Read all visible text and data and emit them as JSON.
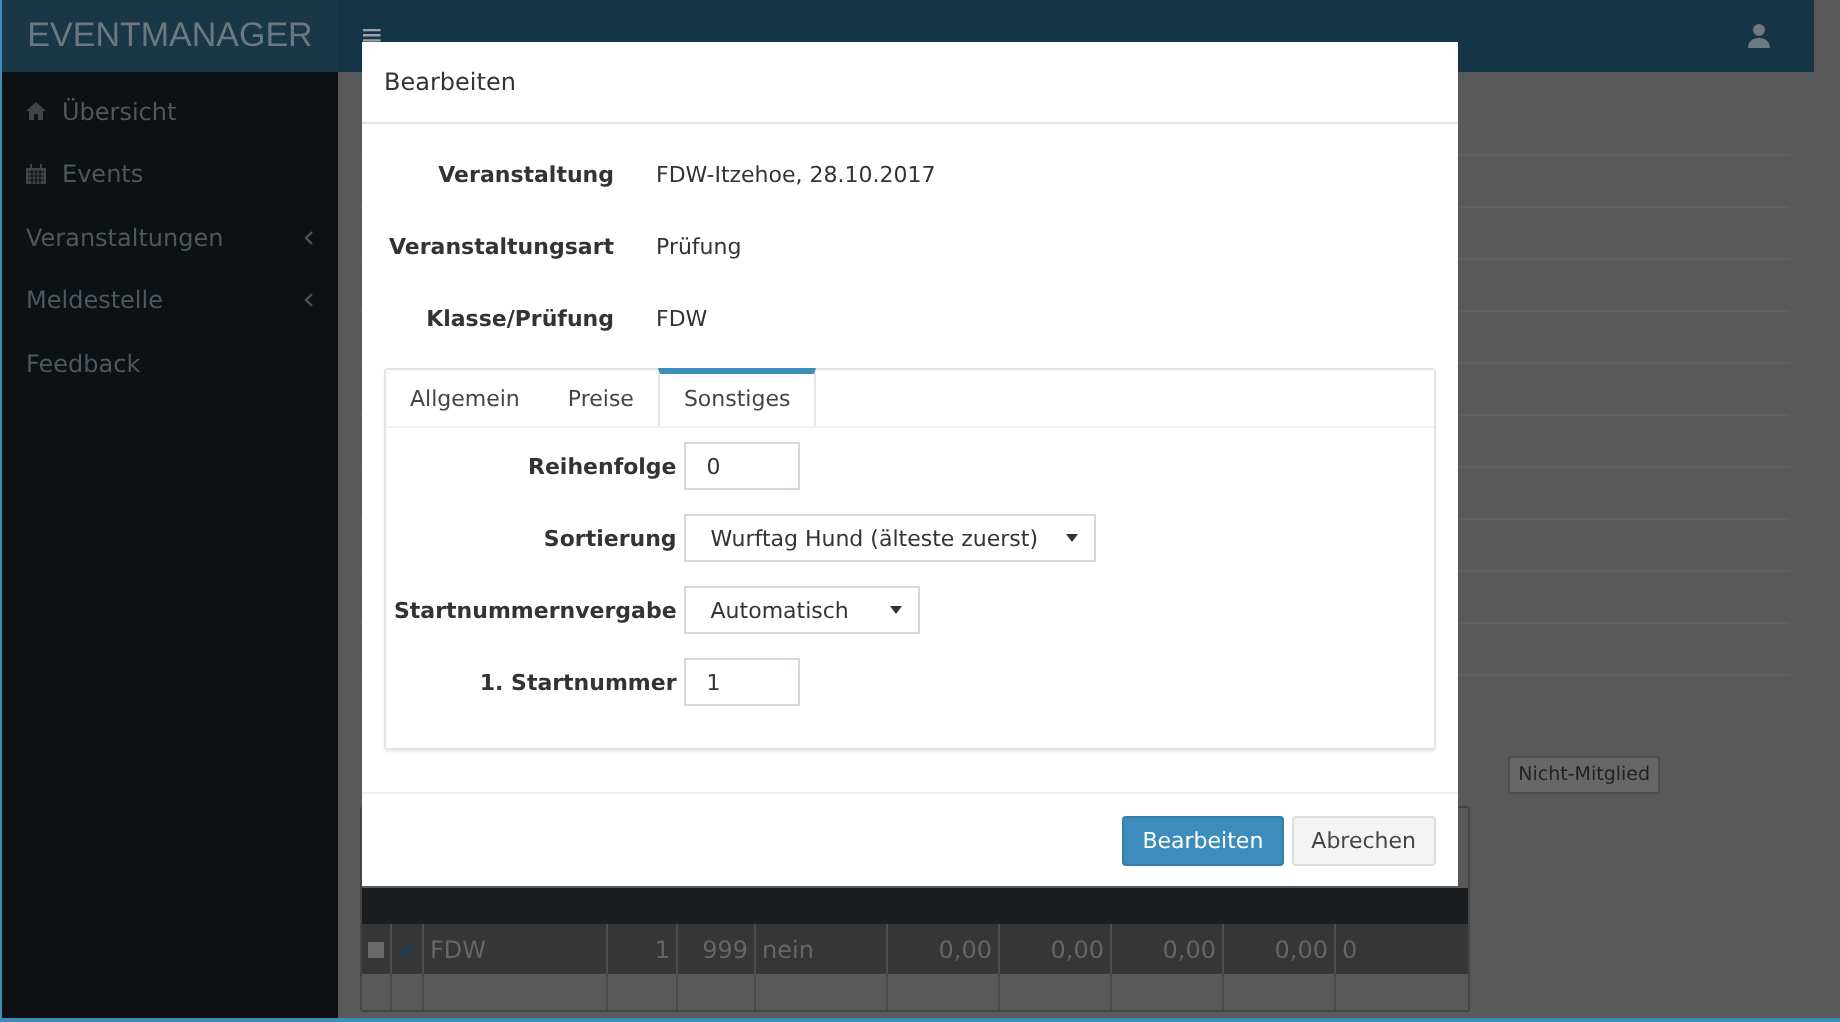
{
  "header": {
    "logo": "EVENTMANAGER",
    "menu_icon": "≡"
  },
  "sidebar": {
    "items": [
      {
        "label": "Übersicht",
        "kind": "home",
        "expandable": false
      },
      {
        "label": "Events",
        "kind": "calendar",
        "expandable": false
      },
      {
        "label": "Veranstaltungen",
        "kind": "none",
        "expandable": true
      },
      {
        "label": "Meldestelle",
        "kind": "none",
        "expandable": true
      },
      {
        "label": "Feedback",
        "kind": "none",
        "expandable": false
      }
    ]
  },
  "background": {
    "member_button": "Nicht-Mitglied",
    "table": {
      "rows": [
        {
          "checked": false,
          "cells": [
            "FDW",
            "1",
            "999",
            "nein",
            "0,00",
            "0,00",
            "0,00",
            "0,00",
            "0"
          ]
        }
      ]
    }
  },
  "modal": {
    "title": "Bearbeiten",
    "fields": [
      {
        "label": "Veranstaltung",
        "value": "FDW-Itzehoe, 28.10.2017"
      },
      {
        "label": "Veranstaltungsart",
        "value": "Prüfung"
      },
      {
        "label": "Klasse/Prüfung",
        "value": "FDW"
      }
    ],
    "tabs": [
      {
        "label": "Allgemein",
        "selected": false
      },
      {
        "label": "Preise",
        "selected": false
      },
      {
        "label": "Sonstiges",
        "selected": true
      }
    ],
    "form": [
      {
        "kind": "input",
        "label": "Reihenfolge",
        "value": "0"
      },
      {
        "kind": "select",
        "label": "Sortierung",
        "value": "Wurftag Hund (älteste zuerst)"
      },
      {
        "kind": "select",
        "label": "Startnummernvergabe",
        "value": "Automatisch"
      },
      {
        "kind": "input",
        "label": "1. Startnummer",
        "value": "1"
      }
    ],
    "buttons": [
      {
        "label": "Bearbeiten",
        "kind": "primary"
      },
      {
        "label": "Abrechen",
        "kind": "default"
      }
    ]
  }
}
